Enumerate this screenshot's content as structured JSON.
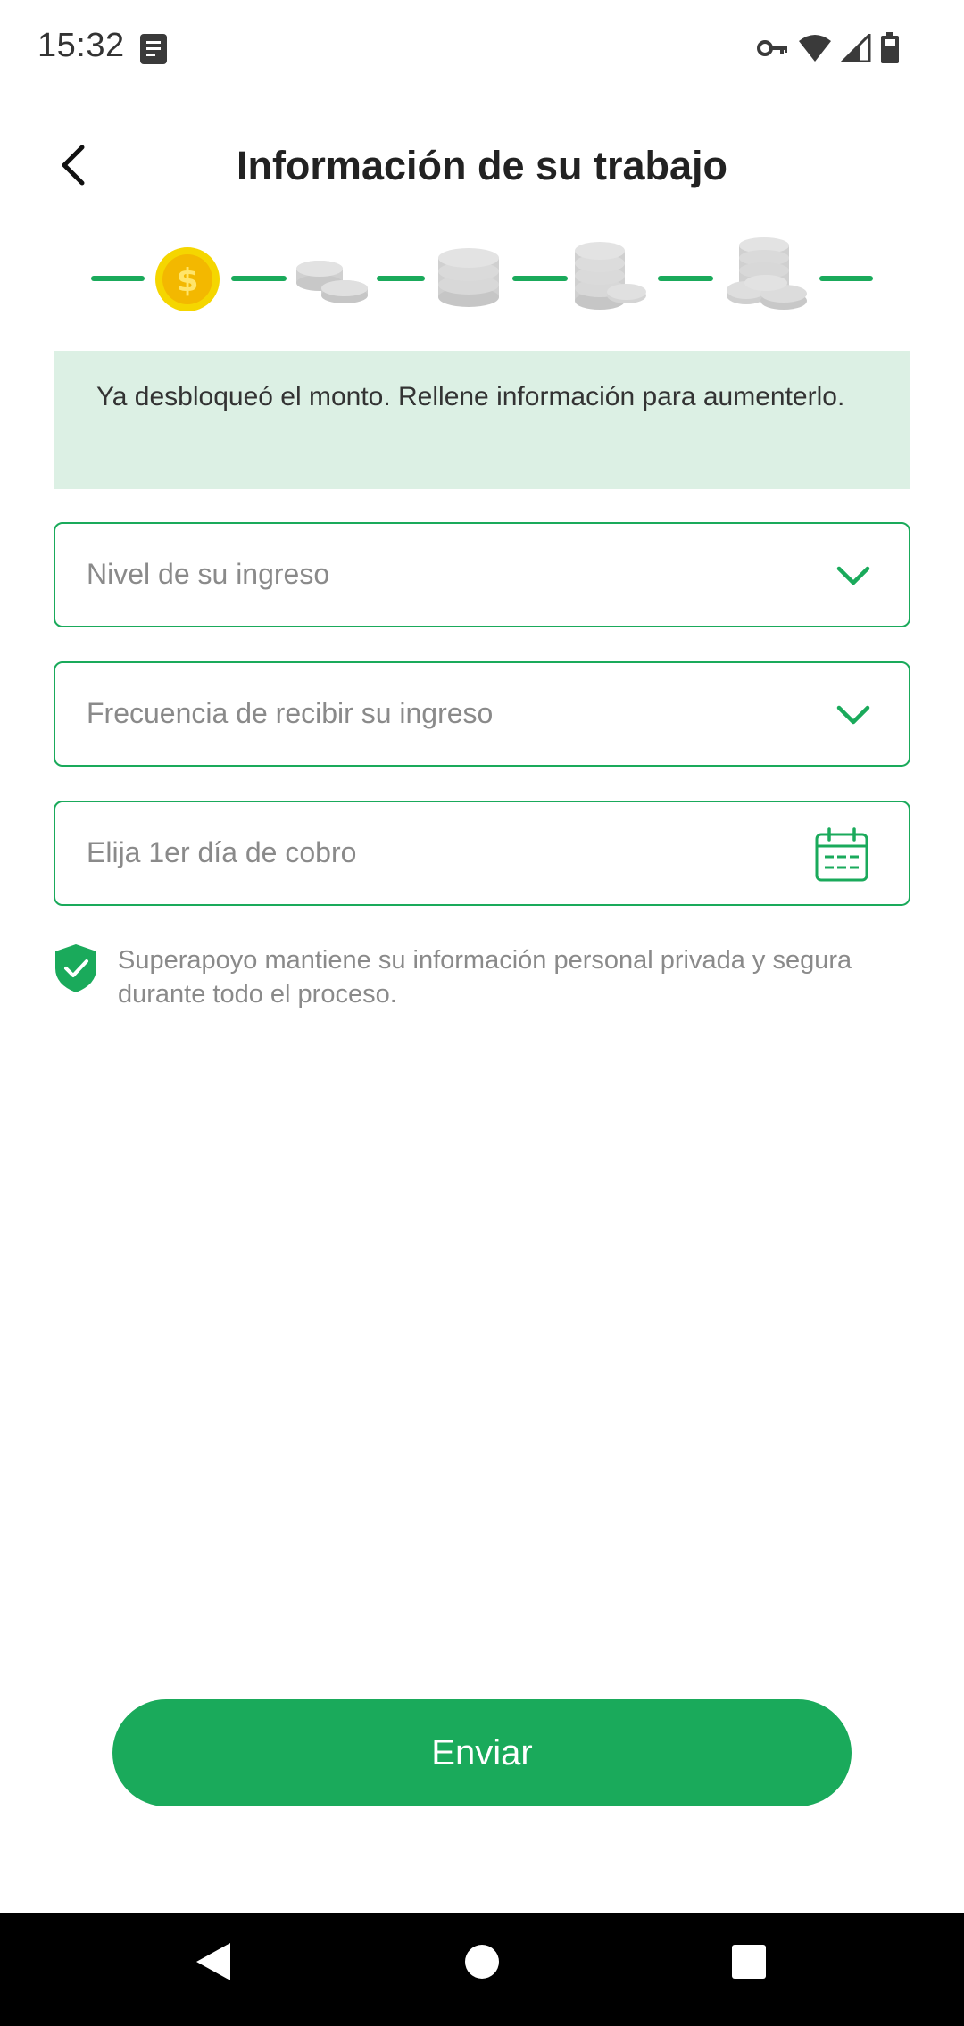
{
  "status_bar": {
    "time": "15:32",
    "icons": [
      "document-icon",
      "key-icon",
      "wifi-icon",
      "signal-icon",
      "battery-icon"
    ]
  },
  "header": {
    "title": "Información de su trabajo",
    "back_icon": "chevron-left-icon"
  },
  "progress": {
    "current_step": 1,
    "total_steps": 5,
    "step_icons": [
      "coin-icon",
      "coins-stack-2-icon",
      "coins-stack-3-icon",
      "coins-stack-4-icon",
      "coins-pile-icon"
    ],
    "colors": {
      "active": "#f5c400",
      "inactive": "#d6d6d6",
      "line": "#1aaa5b"
    }
  },
  "notice": {
    "text": "Ya desbloqueó el monto. Rellene información para aumenterlo."
  },
  "form": {
    "income_level": {
      "placeholder": "Nivel de su ingreso",
      "icon": "chevron-down-icon"
    },
    "income_frequency": {
      "placeholder": "Frecuencia de recibir su ingreso",
      "icon": "chevron-down-icon"
    },
    "first_payday": {
      "placeholder": "Elija 1er día de cobro",
      "icon": "calendar-icon"
    }
  },
  "privacy": {
    "icon": "shield-check-icon",
    "text": "Superapoyo mantiene su información personal privada y segura durante todo el proceso."
  },
  "submit": {
    "label": "Enviar"
  },
  "nav_bar": {
    "icons": [
      "back-triangle-icon",
      "home-circle-icon",
      "recents-square-icon"
    ]
  },
  "theme": {
    "accent": "#1aaa5b",
    "notice_bg": "#dcf0e4",
    "placeholder": "#8a8a8a"
  }
}
